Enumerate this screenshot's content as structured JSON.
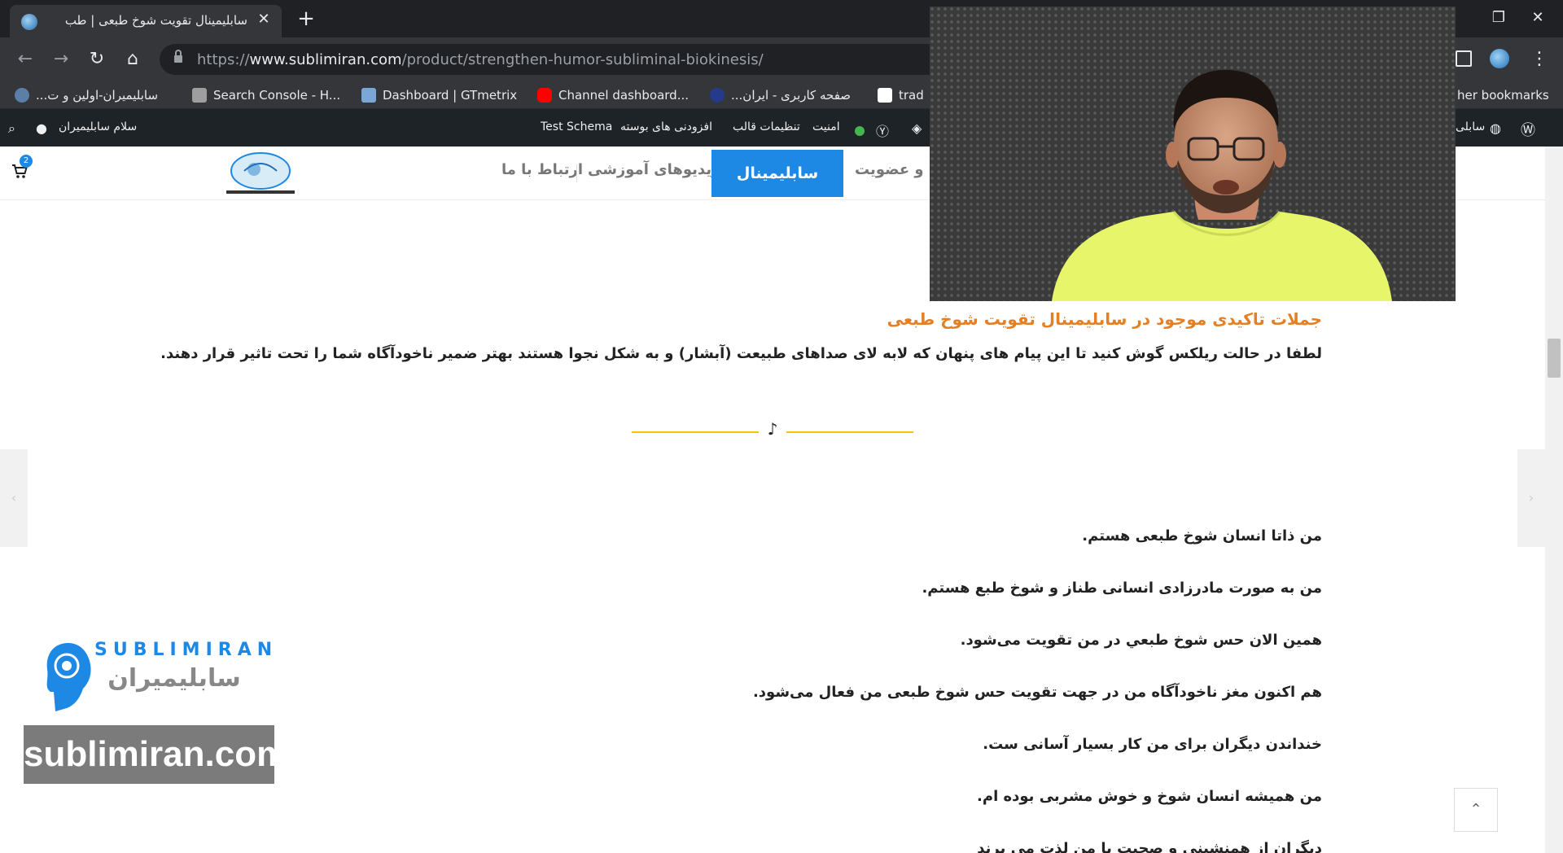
{
  "browser": {
    "tab_title": "سابلیمینال تقویت شوخ طبعی | طب",
    "url_scheme": "https://",
    "url_host": "www.sublimiran.com",
    "url_path": "/product/strengthen-humor-subliminal-biokinesis/",
    "bookmarks": [
      {
        "label": "سابلیمیران-اولین و ت...",
        "icon": "sublimiran-icon",
        "color": "#5b7fa6"
      },
      {
        "label": "Search Console - H...",
        "icon": "search-console-icon",
        "color": "#9e9e9e"
      },
      {
        "label": "Dashboard | GTmetrix",
        "icon": "gtmetrix-icon",
        "color": "#7aa7d6"
      },
      {
        "label": "Channel dashboard...",
        "icon": "youtube-icon",
        "color": "#ff0000"
      },
      {
        "label": "صفحه کاربری - ایران...",
        "icon": "site-icon",
        "color": "#253a8a"
      },
      {
        "label": "trad",
        "icon": "tradingview-icon",
        "color": "#ffffff"
      }
    ],
    "other_bookmarks": "her bookmarks"
  },
  "adminbar": {
    "greeting": "سلام سابلیمیران",
    "test_schema": "Test Schema",
    "plugins": "افزودنی های بوسته",
    "theme_settings": "تنظیمات قالب",
    "security": "امنیت",
    "site_name": "سابلی"
  },
  "header": {
    "cart_count": "2",
    "menu": {
      "contact": "ارتباط با ما",
      "videos": "ویدیوهای آموزشی",
      "what_is": "سابلیمینال چیست",
      "membership": "ید و عضویت"
    }
  },
  "content": {
    "section_title": "جملات تاکیدی موجود در سابلیمینال تقویت شوخ طبعی",
    "intro": "لطفا در حالت ریلکس گوش کنید تا این پیام های پنهان که لابه لای صداهای طبیعت (آبشار) و به شکل نجوا هستند بهتر ضمیر ناخودآگاه شما را تحت تاثیر قرار دهند.",
    "affirmations": [
      "من ذاتا انسان شوخ طبعی هستم.",
      "من به صورت مادرزادی انسانی طناز و شوخ طبع هستم.",
      "همین الان حس شوخ طبعي در من تقویت می‌شود.",
      "هم اکنون مغز ناخودآگاه من در جهت تقویت حس شوخ طبعی من فعال می‌شود.",
      "خنداندن دیگران برای من کار بسیار آسانی ست.",
      "من همیشه انسان شوخ و خوش مشربی بوده ام.",
      "دیگران از همنشینی و صحبت با من لذت می برند"
    ]
  },
  "watermark": {
    "brand_en": "SUBLIMIRAN",
    "brand_fa": "سابلیمیران",
    "url": "sublimiran.com"
  },
  "colors": {
    "accent": "#1e88e5",
    "title_orange": "#e67e22",
    "divider_yellow": "#f1c40f"
  }
}
